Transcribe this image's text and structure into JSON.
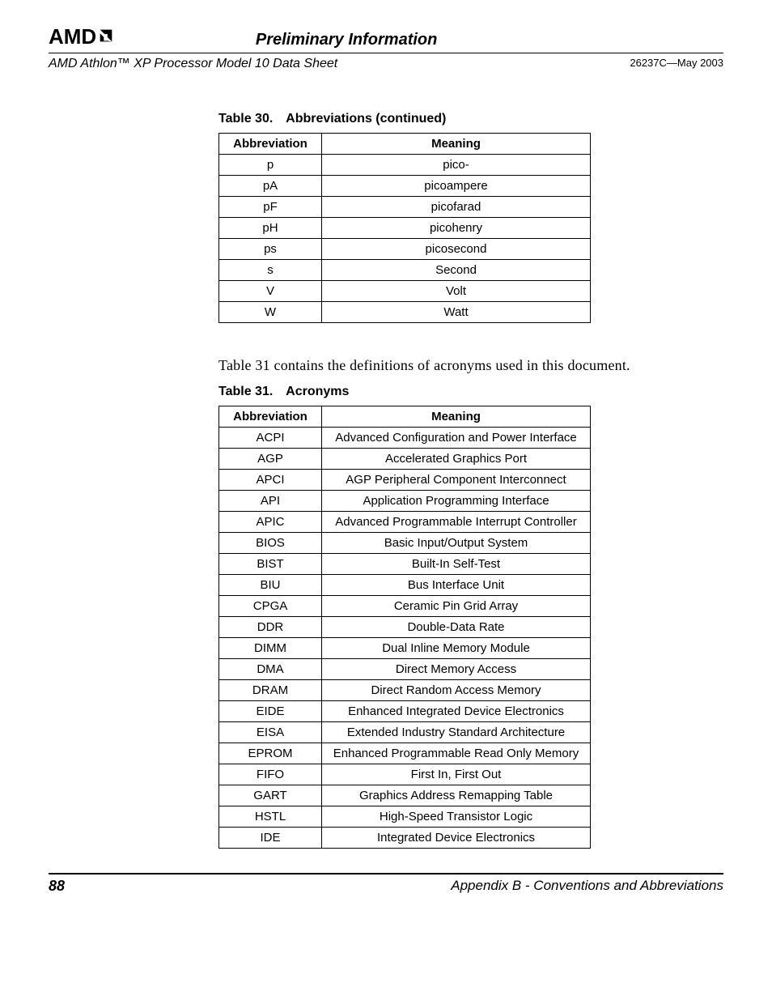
{
  "header": {
    "logo_text": "AMD",
    "prelim": "Preliminary Information",
    "doc_title": "AMD Athlon™ XP Processor Model 10 Data Sheet",
    "doc_id": "26237C—May 2003"
  },
  "table30": {
    "caption_num": "Table 30.",
    "caption_text": "Abbreviations (continued)",
    "head_abbr": "Abbreviation",
    "head_meaning": "Meaning",
    "rows": [
      {
        "abbr": "p",
        "meaning": "pico-"
      },
      {
        "abbr": "pA",
        "meaning": "picoampere"
      },
      {
        "abbr": "pF",
        "meaning": "picofarad"
      },
      {
        "abbr": "pH",
        "meaning": "picohenry"
      },
      {
        "abbr": "ps",
        "meaning": "picosecond"
      },
      {
        "abbr": "s",
        "meaning": "Second"
      },
      {
        "abbr": "V",
        "meaning": "Volt"
      },
      {
        "abbr": "W",
        "meaning": "Watt"
      }
    ]
  },
  "paragraph": "Table 31 contains the definitions of acronyms used in this document.",
  "table31": {
    "caption_num": "Table 31.",
    "caption_text": "Acronyms",
    "head_abbr": "Abbreviation",
    "head_meaning": "Meaning",
    "rows": [
      {
        "abbr": "ACPI",
        "meaning": "Advanced Configuration and Power Interface"
      },
      {
        "abbr": "AGP",
        "meaning": "Accelerated Graphics Port"
      },
      {
        "abbr": "APCI",
        "meaning": "AGP Peripheral Component Interconnect"
      },
      {
        "abbr": "API",
        "meaning": "Application Programming Interface"
      },
      {
        "abbr": "APIC",
        "meaning": "Advanced Programmable Interrupt Controller"
      },
      {
        "abbr": "BIOS",
        "meaning": "Basic Input/Output System"
      },
      {
        "abbr": "BIST",
        "meaning": "Built-In Self-Test"
      },
      {
        "abbr": "BIU",
        "meaning": "Bus Interface Unit"
      },
      {
        "abbr": "CPGA",
        "meaning": "Ceramic Pin Grid Array"
      },
      {
        "abbr": "DDR",
        "meaning": "Double-Data Rate"
      },
      {
        "abbr": "DIMM",
        "meaning": "Dual Inline Memory Module"
      },
      {
        "abbr": "DMA",
        "meaning": "Direct Memory Access"
      },
      {
        "abbr": "DRAM",
        "meaning": "Direct Random Access Memory"
      },
      {
        "abbr": "EIDE",
        "meaning": "Enhanced Integrated Device Electronics"
      },
      {
        "abbr": "EISA",
        "meaning": "Extended Industry Standard Architecture"
      },
      {
        "abbr": "EPROM",
        "meaning": "Enhanced Programmable Read Only Memory"
      },
      {
        "abbr": "FIFO",
        "meaning": "First In, First Out"
      },
      {
        "abbr": "GART",
        "meaning": "Graphics Address Remapping Table"
      },
      {
        "abbr": "HSTL",
        "meaning": "High-Speed Transistor Logic"
      },
      {
        "abbr": "IDE",
        "meaning": "Integrated Device Electronics"
      }
    ]
  },
  "footer": {
    "page_num": "88",
    "appendix": "Appendix B - Conventions and Abbreviations"
  }
}
